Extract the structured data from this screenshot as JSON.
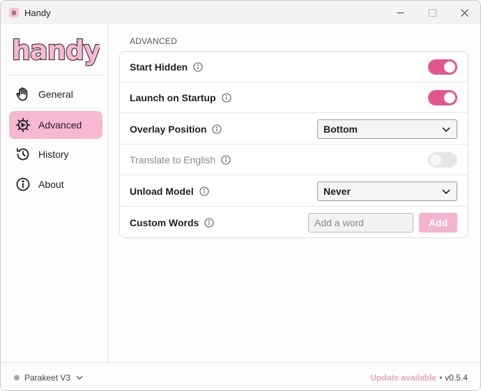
{
  "window": {
    "title": "Handy"
  },
  "sidebar": {
    "logo_text": "handy",
    "items": [
      {
        "label": "General",
        "icon": "hand-icon"
      },
      {
        "label": "Advanced",
        "icon": "cog-icon",
        "active": true
      },
      {
        "label": "History",
        "icon": "history-icon"
      },
      {
        "label": "About",
        "icon": "info-icon"
      }
    ]
  },
  "main": {
    "section_title": "ADVANCED",
    "settings": [
      {
        "label": "Start Hidden",
        "control": "toggle",
        "value": true
      },
      {
        "label": "Launch on Startup",
        "control": "toggle",
        "value": true
      },
      {
        "label": "Overlay Position",
        "control": "select",
        "value": "Bottom"
      },
      {
        "label": "Translate to English",
        "control": "toggle",
        "value": false,
        "disabled": true
      },
      {
        "label": "Unload Model",
        "control": "select",
        "value": "Never"
      },
      {
        "label": "Custom Words",
        "control": "input",
        "placeholder": "Add a word",
        "button_label": "Add"
      }
    ]
  },
  "footer": {
    "model": "Parakeet V3",
    "update_text": "Update available",
    "separator": "•",
    "version": "v0.5.4"
  },
  "colors": {
    "accent": "#e1568f",
    "sidebar_active": "#f7b8d2",
    "update_link": "#ef9fc0",
    "add_button": "#f4b3ce"
  }
}
